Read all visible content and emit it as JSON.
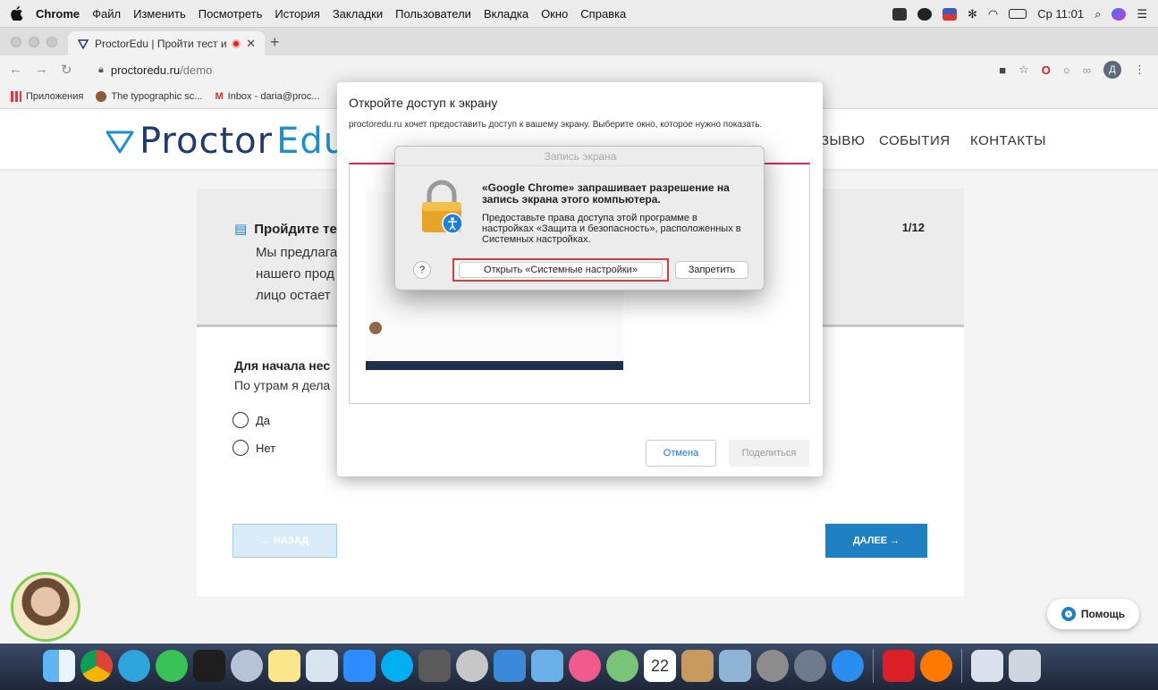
{
  "menubar": {
    "app": "Chrome",
    "items": [
      "Файл",
      "Изменить",
      "Посмотреть",
      "История",
      "Закладки",
      "Пользователи",
      "Вкладка",
      "Окно",
      "Справка"
    ],
    "clock": "Ср 11:01"
  },
  "tab": {
    "title": "ProctorEdu | Пройти тест и"
  },
  "address": {
    "url_host": "proctoredu.ru",
    "url_path": "/demo"
  },
  "bookmarks": [
    "Приложения",
    "The typographic sc...",
    "Inbox - daria@proc..."
  ],
  "avatar_letter": "Д",
  "site": {
    "logo_main": "Proctor",
    "logo_accent": "Edu",
    "nav": [
      "ЗЫВЮ",
      "СОБЫТИЯ",
      "КОНТАКТЫ"
    ]
  },
  "test": {
    "title": "Пройдите те",
    "desc_lines": [
      "Мы предлага",
      "нашего прод",
      "лицо остает"
    ],
    "counter": "1/12",
    "question_title": "Для начала нес",
    "question_text": "По утрам я дела",
    "options": [
      "Да",
      "Нет"
    ],
    "back_label": "← НАЗАД",
    "next_label": "ДАЛЕЕ →"
  },
  "help_label": "Помощь",
  "share_dialog": {
    "title": "Откройте доступ к экрану",
    "subtitle": "proctoredu.ru хочет предоставить доступ к вашему экрану. Выберите окно, которое нужно показать.",
    "cancel": "Отмена",
    "share": "Поделиться"
  },
  "mac_alert": {
    "title": "Запись экрана",
    "heading": "«Google Chrome» запрашивает разрешение на запись экрана этого компьютера.",
    "body": "Предоставьте права доступа этой программе в настройках «Защита и безопасность», расположенных в Системных настройках.",
    "help": "?",
    "open_settings": "Открыть «Системные настройки»",
    "deny": "Запретить"
  },
  "colors": {
    "brand_dark": "#1f3a6e",
    "brand_blue": "#1e7fc1",
    "highlight_red": "#e53935"
  },
  "dock_icons": [
    "finder-icon",
    "chrome-icon",
    "telegram-icon",
    "whatsapp-icon",
    "figma-icon",
    "no-entry-icon",
    "notes-icon",
    "preview-icon",
    "zoom-icon",
    "skype-icon",
    "calculator-icon",
    "no-entry-icon",
    "keynote-icon",
    "mail-icon",
    "music-icon",
    "safari-icon",
    "calendar-icon",
    "contacts-icon",
    "photos-icon",
    "preferences-icon",
    "launchpad-icon",
    "appstore-icon",
    "creative-cloud-icon",
    "avast-icon",
    "documents-icon",
    "trash-icon"
  ],
  "calendar_day": "22"
}
